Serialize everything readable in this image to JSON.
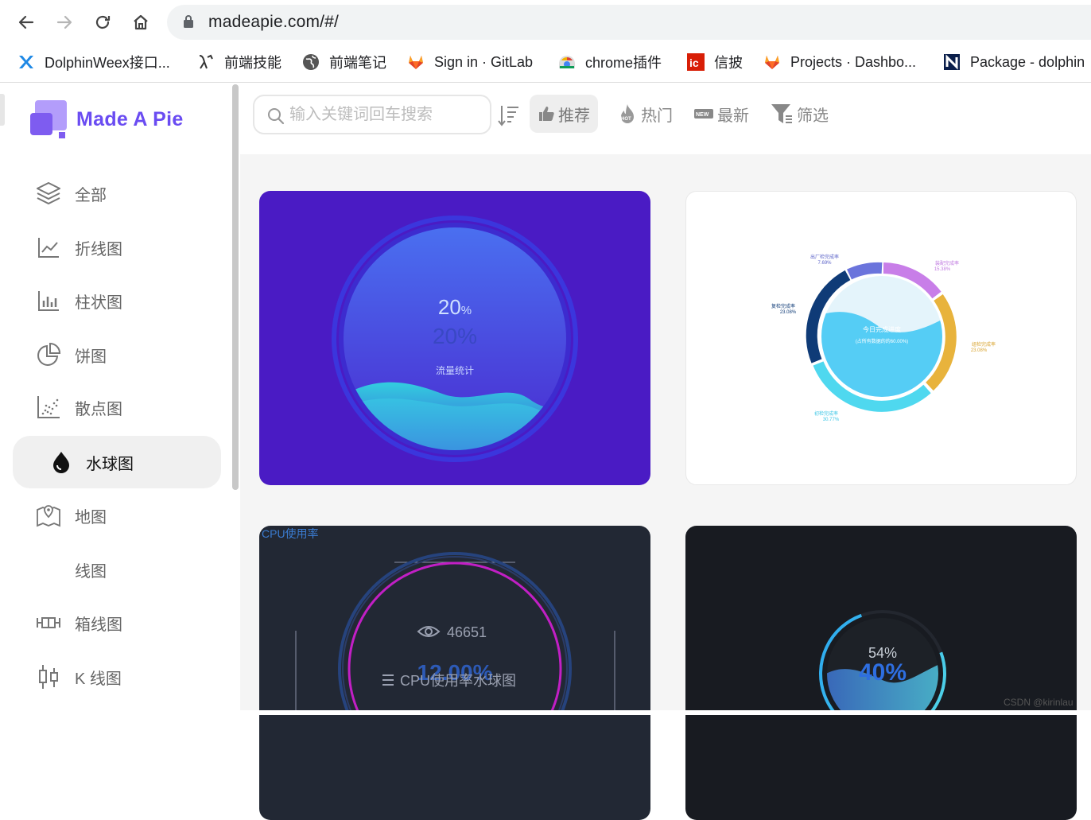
{
  "browser": {
    "url": "madeapie.com/#/",
    "bookmarks": [
      {
        "label": "DolphinWeex接口...",
        "icon": "dolphin-icon"
      },
      {
        "label": "前端技能",
        "icon": "lambda-icon"
      },
      {
        "label": "前端笔记",
        "icon": "globe-icon"
      },
      {
        "label": "Sign in · GitLab",
        "icon": "gitlab-icon"
      },
      {
        "label": "chrome插件",
        "icon": "chrome-icon"
      },
      {
        "label": "信披",
        "icon": "xinpi-icon"
      },
      {
        "label": "Projects · Dashbo...",
        "icon": "gitlab-icon"
      },
      {
        "label": "Package - dolphin",
        "icon": "n-icon"
      }
    ]
  },
  "sidebar": {
    "logo": "Made A Pie",
    "items": [
      {
        "label": "全部",
        "icon": "layers-icon"
      },
      {
        "label": "折线图",
        "icon": "line-chart-icon"
      },
      {
        "label": "柱状图",
        "icon": "bar-chart-icon"
      },
      {
        "label": "饼图",
        "icon": "pie-chart-icon"
      },
      {
        "label": "散点图",
        "icon": "scatter-chart-icon"
      },
      {
        "label": "水球图",
        "icon": "drop-icon",
        "active": true
      },
      {
        "label": "地图",
        "icon": "map-icon"
      },
      {
        "label": "线图",
        "icon": ""
      },
      {
        "label": "箱线图",
        "icon": "boxplot-icon"
      },
      {
        "label": "K 线图",
        "icon": "candlestick-icon"
      }
    ]
  },
  "toolbar": {
    "search_placeholder": "输入关键词回车搜索",
    "recommend": "推荐",
    "hot": "热门",
    "latest": "最新",
    "filter": "筛选",
    "hot_badge": "HOT",
    "new_badge": "NEW"
  },
  "cards": {
    "c1": {
      "value": "20",
      "value_unit": "%",
      "ghost": "20%",
      "label": "流量统计"
    },
    "c2": {
      "center_title": "今日完成进度",
      "center_sub": "(占所有数据的的60.00%)",
      "labels": [
        {
          "name": "出厂检完成率",
          "pct": "7.69%"
        },
        {
          "name": "装配完成率",
          "pct": "15.38%"
        },
        {
          "name": "组检完成率",
          "pct": "23.08%"
        },
        {
          "name": "初检完成率",
          "pct": "30.77%"
        },
        {
          "name": "复检完成率",
          "pct": "23.08%"
        }
      ]
    },
    "c3": {
      "title": "CPU使用率",
      "views": "46651",
      "value": "12.00%",
      "card_title": "CPU使用率水球图"
    },
    "c4": {
      "outer": "54%",
      "inner": "40%"
    }
  },
  "watermark": "CSDN @kirinlau"
}
